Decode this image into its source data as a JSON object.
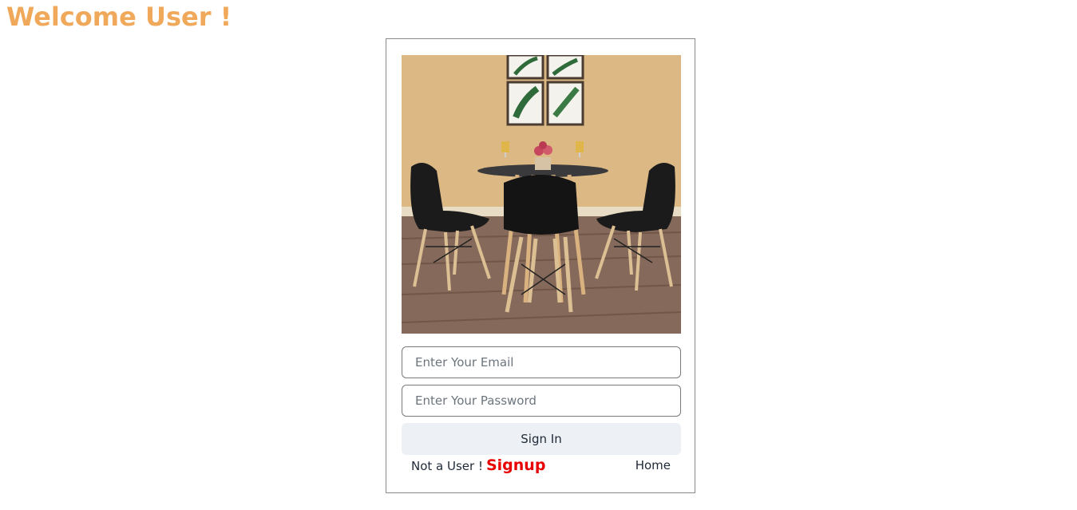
{
  "header": {
    "title": "Welcome User !"
  },
  "login": {
    "image": {
      "semantic": "dining-table-with-chairs-photo"
    },
    "email": {
      "placeholder": "Enter Your Email",
      "value": ""
    },
    "password": {
      "placeholder": "Enter Your Password",
      "value": ""
    },
    "signin_label": "Sign In",
    "not_user_text": "Not a User !",
    "signup_label": "Signup",
    "home_label": "Home"
  },
  "colors": {
    "welcome": "#f0a95a",
    "signup": "#e80000",
    "button_bg": "#edf1f6",
    "card_border": "#8a8a8a"
  }
}
